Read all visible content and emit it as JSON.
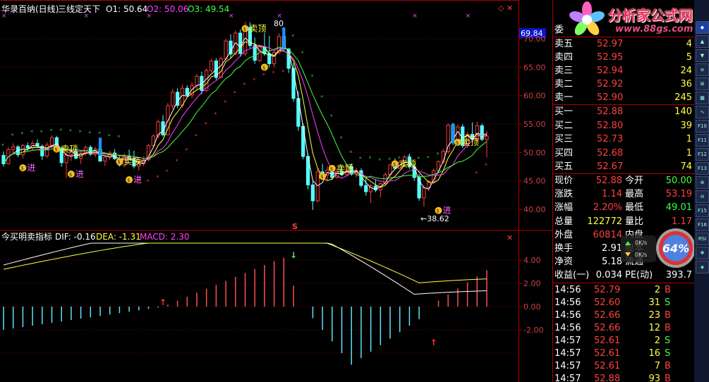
{
  "main_header": {
    "stock_name": "华录百纳(日线)",
    "indicator_name": "三线定天下",
    "o1": "O1: 50.64",
    "o2": "O2: 50.06",
    "o3": "O3: 49.54"
  },
  "macd_header": {
    "name": "今买明卖指标",
    "dif": "DIF: -0.16",
    "dea": "DEA: -1.31",
    "macd": "MACD: 2.30"
  },
  "price_axis": {
    "labels": [
      "70.00",
      "65.00",
      "60.00",
      "55.00",
      "50.00",
      "45.00",
      "40.00"
    ],
    "current_value": "69.84"
  },
  "macd_axis": {
    "labels": [
      "4.00",
      "2.00",
      "0.00",
      "-2.00"
    ]
  },
  "annotations": {
    "high_label": "80",
    "low_label": "←38.62",
    "s_marker": "S",
    "jin": "进",
    "ding": "卖顶"
  },
  "colors": {
    "up": "#ff3c3c",
    "down": "#54ffff",
    "grid": "#800000",
    "axis": "#b00000",
    "ma_white": "#ffffff",
    "ma_yellow": "#ffff40",
    "ma_magenta": "#ff40ff",
    "ma_green": "#40ff40",
    "sar_red": "#ff3030",
    "sar_green": "#30c030"
  },
  "logo": {
    "title": "分析家公式网",
    "url": "www.88gs.com",
    "icon": "flower-logo-icon"
  },
  "quote": {
    "order_ratio_label": "委",
    "asks": [
      {
        "label": "卖五",
        "price": "52.97",
        "vol": "4"
      },
      {
        "label": "卖四",
        "price": "52.95",
        "vol": "5"
      },
      {
        "label": "卖三",
        "price": "52.94",
        "vol": "24"
      },
      {
        "label": "卖二",
        "price": "52.92",
        "vol": "36"
      },
      {
        "label": "卖一",
        "price": "52.90",
        "vol": "245"
      }
    ],
    "bids": [
      {
        "label": "买一",
        "price": "52.88",
        "vol": "140"
      },
      {
        "label": "买二",
        "price": "52.80",
        "vol": "39"
      },
      {
        "label": "买三",
        "price": "52.73",
        "vol": "1"
      },
      {
        "label": "买四",
        "price": "52.68",
        "vol": "1"
      },
      {
        "label": "买五",
        "price": "52.67",
        "vol": "74"
      }
    ],
    "stats": [
      {
        "l1": "现价",
        "v1": "52.88",
        "l2": "今开",
        "v2": "50.00",
        "c1": "#ff4040",
        "c2": "#40ff40"
      },
      {
        "l1": "涨跌",
        "v1": "1.14",
        "l2": "最高",
        "v2": "53.19",
        "c1": "#ff4040",
        "c2": "#ff4040"
      },
      {
        "l1": "涨幅",
        "v1": "2.20%",
        "l2": "最低",
        "v2": "49.01",
        "c1": "#ff4040",
        "c2": "#40ff40"
      },
      {
        "l1": "总量",
        "v1": "122772",
        "l2": "量比",
        "v2": "1.17",
        "c1": "#ffff40",
        "c2": "#ff4040"
      },
      {
        "l1": "外盘",
        "v1": "60814",
        "l2": "内盘",
        "v2": "",
        "c1": "#ff4040",
        "c2": "#40ff40"
      },
      {
        "l1": "换手",
        "v1": "2.91",
        "l2": "股本",
        "v2": "",
        "c1": "#ffffff",
        "c2": "#ffffff"
      },
      {
        "l1": "净资",
        "v1": "5.18",
        "l2": "流通",
        "v2": "",
        "c1": "#ffffff",
        "c2": "#ffffff"
      },
      {
        "l1": "收益(一)",
        "v1": "0.034",
        "l2": "PE(动)",
        "v2": "393.7",
        "c1": "#ffffff",
        "c2": "#ffffff"
      }
    ],
    "ticks": [
      {
        "time": "14:56",
        "price": "52.79",
        "vol": "2",
        "side": "B"
      },
      {
        "time": "14:56",
        "price": "52.60",
        "vol": "31",
        "side": "S"
      },
      {
        "time": "14:56",
        "price": "52.66",
        "vol": "23",
        "side": "B"
      },
      {
        "time": "14:56",
        "price": "52.66",
        "vol": "12",
        "side": "B"
      },
      {
        "time": "14:57",
        "price": "52.61",
        "vol": "2",
        "side": "S"
      },
      {
        "time": "14:57",
        "price": "52.61",
        "vol": "16",
        "side": "S"
      },
      {
        "time": "14:57",
        "price": "52.61",
        "vol": "7",
        "side": "B"
      },
      {
        "time": "14:57",
        "price": "52.88",
        "vol": "93",
        "side": "B"
      }
    ]
  },
  "widget": {
    "gauge_percent": "64%",
    "up_speed": "0K/s",
    "down_speed": "0K/s"
  },
  "toolbar": {
    "buttons": [
      "◆",
      "▲",
      "▼",
      "≡",
      "⊞",
      "▦",
      "∿",
      "F10",
      "F11",
      "F12",
      "F13",
      "⊕",
      "⊖",
      "F15",
      "F16",
      "RSI",
      "✥",
      "◈"
    ]
  },
  "chart_data": {
    "type": "candlestick",
    "title": "华录百纳(日线) 三线定天下",
    "ylim": [
      37.5,
      72.5
    ],
    "y_ticks": [
      40,
      45,
      50,
      55,
      60,
      65,
      70
    ],
    "ohlc": [
      [
        49.5,
        50.2,
        47.5,
        48.0
      ],
      [
        48.0,
        51.0,
        47.9,
        50.5
      ],
      [
        50.5,
        51.6,
        49.6,
        51.0
      ],
      [
        51.0,
        51.3,
        49.2,
        49.6
      ],
      [
        49.6,
        51.5,
        49.0,
        51.2
      ],
      [
        51.2,
        51.8,
        50.3,
        50.8
      ],
      [
        50.8,
        52.1,
        50.4,
        51.6
      ],
      [
        51.6,
        52.3,
        50.8,
        51.1
      ],
      [
        51.1,
        51.4,
        48.7,
        49.4
      ],
      [
        49.4,
        51.8,
        49.0,
        51.3
      ],
      [
        51.3,
        53.0,
        51.0,
        52.6
      ],
      [
        52.6,
        52.9,
        50.3,
        50.8
      ],
      [
        50.8,
        51.1,
        47.5,
        48.2
      ],
      [
        48.2,
        50.2,
        45.5,
        49.6
      ],
      [
        49.6,
        51.0,
        48.5,
        50.2
      ],
      [
        50.2,
        50.6,
        48.8,
        49.0
      ],
      [
        49.0,
        50.3,
        48.0,
        49.8
      ],
      [
        49.8,
        51.2,
        49.5,
        50.9
      ],
      [
        50.9,
        51.3,
        49.4,
        49.7
      ],
      [
        49.7,
        51.0,
        49.2,
        50.6
      ],
      [
        50.6,
        50.9,
        48.3,
        48.5
      ],
      [
        48.5,
        49.5,
        47.6,
        49.2
      ],
      [
        49.2,
        50.3,
        48.7,
        49.9
      ],
      [
        49.9,
        50.6,
        48.7,
        48.9
      ],
      [
        48.9,
        49.6,
        47.5,
        47.8
      ],
      [
        47.8,
        49.8,
        47.4,
        49.4
      ],
      [
        49.4,
        50.5,
        48.7,
        49.0
      ],
      [
        49.0,
        50.3,
        47.2,
        47.6
      ],
      [
        47.6,
        48.4,
        46.8,
        48.0
      ],
      [
        48.0,
        49.3,
        47.6,
        48.7
      ],
      [
        48.7,
        51.5,
        48.5,
        51.2
      ],
      [
        51.2,
        53.2,
        51.0,
        52.9
      ],
      [
        52.9,
        55.8,
        52.5,
        55.4
      ],
      [
        55.4,
        56.6,
        52.8,
        53.1
      ],
      [
        53.1,
        58.7,
        53.0,
        58.2
      ],
      [
        58.2,
        61.2,
        57.6,
        60.6
      ],
      [
        60.6,
        61.3,
        57.8,
        58.3
      ],
      [
        58.3,
        61.9,
        57.9,
        61.3
      ],
      [
        61.3,
        61.8,
        59.8,
        60.1
      ],
      [
        60.1,
        62.3,
        59.6,
        61.8
      ],
      [
        61.8,
        63.8,
        61.0,
        63.4
      ],
      [
        63.4,
        64.2,
        60.2,
        60.9
      ],
      [
        60.9,
        64.8,
        60.6,
        64.4
      ],
      [
        64.4,
        66.4,
        64.1,
        66.1
      ],
      [
        66.1,
        66.6,
        62.8,
        63.2
      ],
      [
        63.2,
        66.8,
        63.1,
        66.5
      ],
      [
        66.5,
        70.0,
        66.2,
        69.6
      ],
      [
        69.6,
        70.8,
        66.6,
        67.3
      ],
      [
        67.3,
        71.5,
        67.1,
        71.0
      ],
      [
        71.0,
        71.6,
        66.8,
        67.4
      ],
      [
        67.4,
        73.0,
        66.9,
        72.0
      ],
      [
        72.0,
        72.9,
        68.3,
        68.8
      ],
      [
        68.8,
        70.2,
        65.6,
        66.2
      ],
      [
        66.2,
        69.0,
        65.9,
        68.6
      ],
      [
        68.6,
        71.1,
        67.0,
        67.4
      ],
      [
        67.4,
        70.5,
        65.0,
        65.6
      ],
      [
        65.6,
        68.0,
        64.9,
        67.6
      ],
      [
        67.6,
        71.0,
        67.3,
        70.4
      ],
      [
        70.4,
        71.0,
        67.7,
        68.2
      ],
      [
        68.2,
        68.4,
        64.0,
        64.8
      ],
      [
        64.8,
        65.7,
        58.9,
        59.5
      ],
      [
        59.5,
        60.8,
        53.8,
        54.6
      ],
      [
        54.6,
        55.1,
        48.8,
        49.3
      ],
      [
        49.3,
        49.8,
        43.5,
        44.3
      ],
      [
        44.3,
        45.0,
        39.9,
        41.5
      ],
      [
        41.5,
        47.2,
        41.2,
        46.6
      ],
      [
        46.6,
        48.0,
        45.4,
        46.0
      ],
      [
        46.0,
        47.6,
        45.0,
        46.9
      ],
      [
        46.9,
        47.0,
        45.2,
        45.6
      ],
      [
        45.6,
        47.2,
        45.4,
        46.7
      ],
      [
        46.7,
        47.6,
        45.8,
        46.1
      ],
      [
        46.1,
        47.8,
        45.8,
        47.5
      ],
      [
        47.5,
        48.1,
        45.9,
        46.2
      ],
      [
        46.2,
        47.3,
        45.6,
        46.8
      ],
      [
        46.8,
        47.2,
        43.8,
        44.2
      ],
      [
        44.2,
        45.6,
        42.4,
        43.1
      ],
      [
        43.1,
        44.5,
        41.1,
        44.1
      ],
      [
        44.1,
        45.3,
        43.0,
        43.4
      ],
      [
        43.4,
        44.7,
        42.1,
        44.5
      ],
      [
        44.5,
        46.5,
        44.2,
        46.1
      ],
      [
        46.1,
        48.0,
        45.7,
        47.8
      ],
      [
        47.8,
        49.0,
        47.0,
        47.2
      ],
      [
        47.2,
        48.6,
        47.0,
        48.3
      ],
      [
        48.3,
        49.5,
        47.6,
        49.2
      ],
      [
        49.2,
        49.8,
        47.1,
        47.5
      ],
      [
        47.5,
        48.0,
        45.0,
        45.6
      ],
      [
        45.6,
        46.2,
        41.5,
        42.0
      ],
      [
        42.0,
        44.2,
        40.5,
        43.8
      ],
      [
        43.8,
        45.2,
        43.2,
        44.9
      ],
      [
        44.9,
        47.2,
        44.6,
        46.8
      ],
      [
        46.8,
        48.6,
        46.3,
        48.4
      ],
      [
        48.4,
        50.6,
        48.0,
        50.2
      ],
      [
        50.2,
        55.1,
        49.8,
        54.8
      ],
      [
        54.8,
        55.2,
        51.3,
        51.8
      ],
      [
        51.8,
        54.9,
        51.6,
        54.5
      ],
      [
        54.5,
        55.0,
        50.8,
        51.2
      ],
      [
        51.2,
        53.6,
        50.8,
        53.2
      ],
      [
        53.2,
        55.3,
        51.8,
        52.3
      ],
      [
        52.3,
        55.4,
        51.9,
        54.7
      ],
      [
        54.7,
        55.1,
        52.0,
        52.3
      ],
      [
        52.3,
        53.8,
        49.1,
        52.9
      ]
    ]
  }
}
